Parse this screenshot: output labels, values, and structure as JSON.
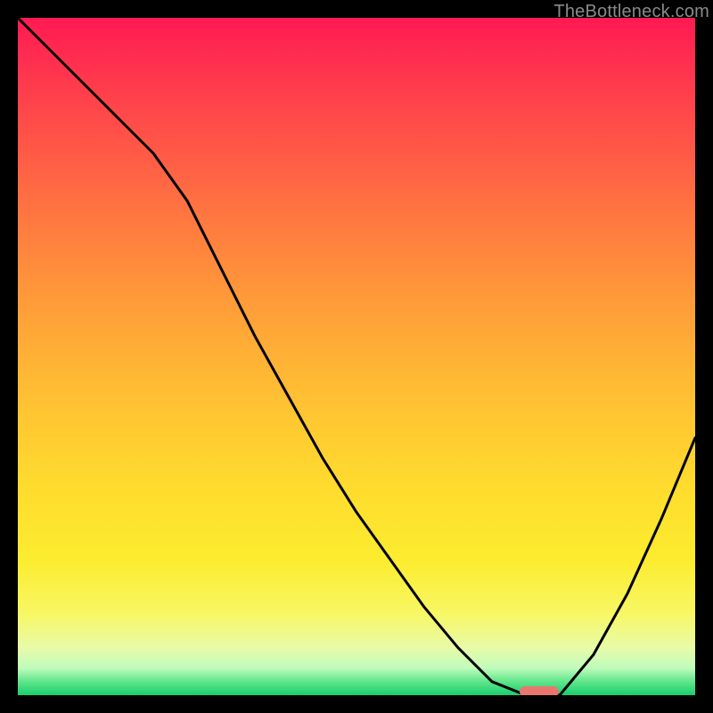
{
  "watermark": "TheBottleneck.com",
  "chart_data": {
    "type": "line",
    "title": "",
    "xlabel": "",
    "ylabel": "",
    "xlim": [
      0,
      100
    ],
    "ylim": [
      0,
      100
    ],
    "x": [
      0,
      5,
      10,
      15,
      20,
      25,
      30,
      35,
      40,
      45,
      50,
      55,
      60,
      65,
      70,
      75,
      80,
      85,
      90,
      95,
      100
    ],
    "values": [
      100,
      95,
      90,
      85,
      80,
      73,
      63,
      53,
      44,
      35,
      27,
      20,
      13,
      7,
      2,
      0,
      0,
      6,
      15,
      26,
      38
    ],
    "marker": {
      "x": 77,
      "y": 0
    },
    "gradient_stops": [
      {
        "pos": 0,
        "color": "#ff1a52"
      },
      {
        "pos": 50,
        "color": "#ffb135"
      },
      {
        "pos": 88,
        "color": "#f8f765"
      },
      {
        "pos": 100,
        "color": "#18cf6f"
      }
    ]
  }
}
